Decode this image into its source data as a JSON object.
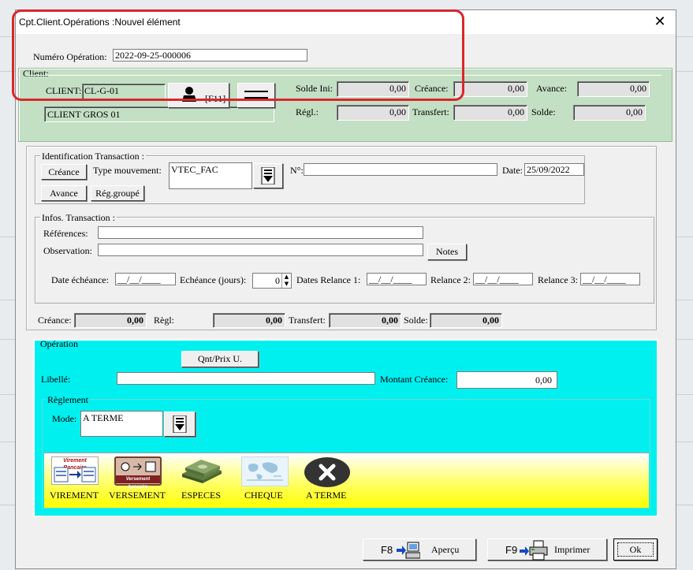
{
  "window": {
    "title": "Cpt.Client.Opérations :Nouvel élément",
    "close_icon": "close-icon"
  },
  "header": {
    "numero_label": "Numéro Opération:",
    "numero_value": "2022-09-25-000006"
  },
  "client": {
    "group_label": "Client:",
    "client_label": "CLIENT:",
    "client_code": "CL-G-01",
    "client_name": "CLIENT GROS 01",
    "f11_label": "[F11]",
    "person_icon": "person-icon",
    "menu_icon": "double-bar-icon",
    "solde_ini_label": "Solde Ini:",
    "solde_ini": "0,00",
    "creance_label": "Créance:",
    "creance": "0,00",
    "avance_label": "Avance:",
    "avance": "0,00",
    "regl_label": "Régl.:",
    "regl": "0,00",
    "transfert_label": "Transfert:",
    "transfert": "0,00",
    "solde_label": "Solde:",
    "solde": "0,00"
  },
  "identification": {
    "group_label": "Identification Transaction :",
    "creance_btn": "Créance",
    "avance_btn": "Avance",
    "type_label": "Type mouvement:",
    "type_value": "VTEC_FAC",
    "reg_groupe_btn": "Rég.groupé",
    "num_label": "N°:",
    "num_value": "",
    "date_label": "Date:",
    "date_value": "25/09/2022"
  },
  "infos": {
    "group_label": "Infos. Transaction :",
    "references_label": "Références:",
    "observation_label": "Observation:",
    "notes_btn": "Notes",
    "date_echeance_label": "Date échéance:",
    "date_echeance_value": "__/__/____",
    "echeance_jours_label": "Echéance (jours):",
    "echeance_jours_value": "0",
    "dates_relance1_label": "Dates Relance 1:",
    "relance1_value": "__/__/____",
    "relance2_label": "Relance 2:",
    "relance2_value": "__/__/____",
    "relance3_label": "Relance 3:",
    "relance3_value": "__/__/____"
  },
  "totals": {
    "creance_label": "Créance:",
    "creance": "0,00",
    "regl_label": "Règl:",
    "regl": "0,00",
    "transfert_label": "Transfert:",
    "transfert": "0,00",
    "solde_label": "Solde:",
    "solde": "0,00"
  },
  "operation": {
    "group_label": "Opération",
    "qnt_prix_btn": "Qnt/Prix U.",
    "libelle_label": "Libellé:",
    "libelle_value": "",
    "montant_label": "Montant Créance:",
    "montant_value": "0,00",
    "reglement_label": "Règlement",
    "mode_label": "Mode:",
    "mode_value": "A TERME",
    "payment_methods": [
      {
        "label": "VIREMENT",
        "caption": "Virement Bancaire",
        "icon": "bank-transfer-icon"
      },
      {
        "label": "VERSEMENT",
        "caption": "Versement bancaire",
        "icon": "bank-deposit-icon"
      },
      {
        "label": "ESPECES",
        "icon": "cash-icon"
      },
      {
        "label": "CHEQUE",
        "icon": "cheque-icon"
      },
      {
        "label": "A TERME",
        "icon": "cancel-x-icon"
      }
    ]
  },
  "footer": {
    "apercu_key": "F8",
    "apercu_label": "Aperçu",
    "imprimer_key": "F9",
    "imprimer_label": "Imprimer",
    "ok_label": "Ok"
  },
  "colors": {
    "green_panel": "#c3dfc4",
    "cyan_panel": "#00f0f0",
    "yellow_gradient": "#ffff00",
    "red_annotation": "#d9262d"
  }
}
